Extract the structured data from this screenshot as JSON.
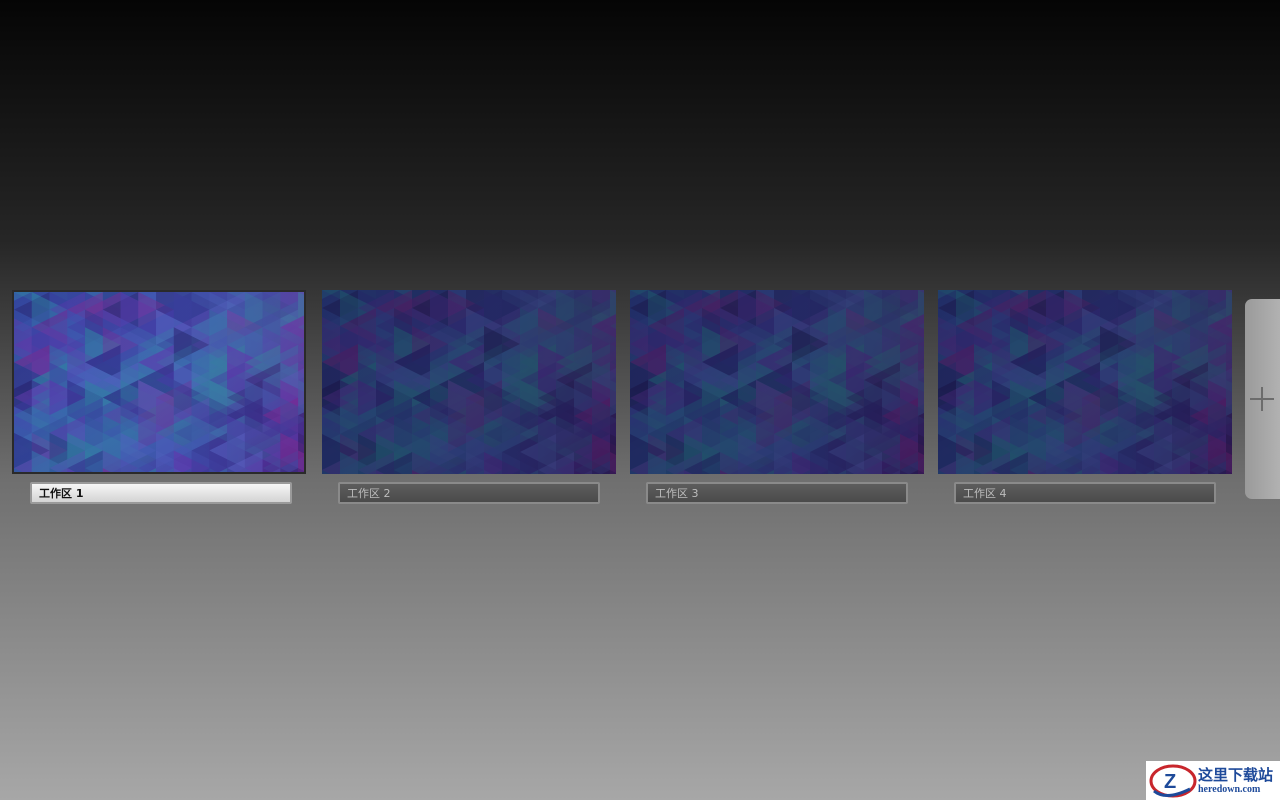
{
  "workspaces": [
    {
      "label": "工作区 1",
      "active": true
    },
    {
      "label": "工作区 2",
      "active": false
    },
    {
      "label": "工作区 3",
      "active": false
    },
    {
      "label": "工作区 4",
      "active": false
    }
  ],
  "add_workspace": {
    "icon": "plus-icon"
  },
  "watermark": {
    "cn": "这里下载站",
    "en": "heredown.com",
    "logo": "z-logo-icon"
  },
  "colors": {
    "wallpaper_blue": "#2a6fb0",
    "wallpaper_purple": "#5a2a9a",
    "wallpaper_teal": "#1f8a9a",
    "wallpaper_navy": "#1a1f6a"
  }
}
